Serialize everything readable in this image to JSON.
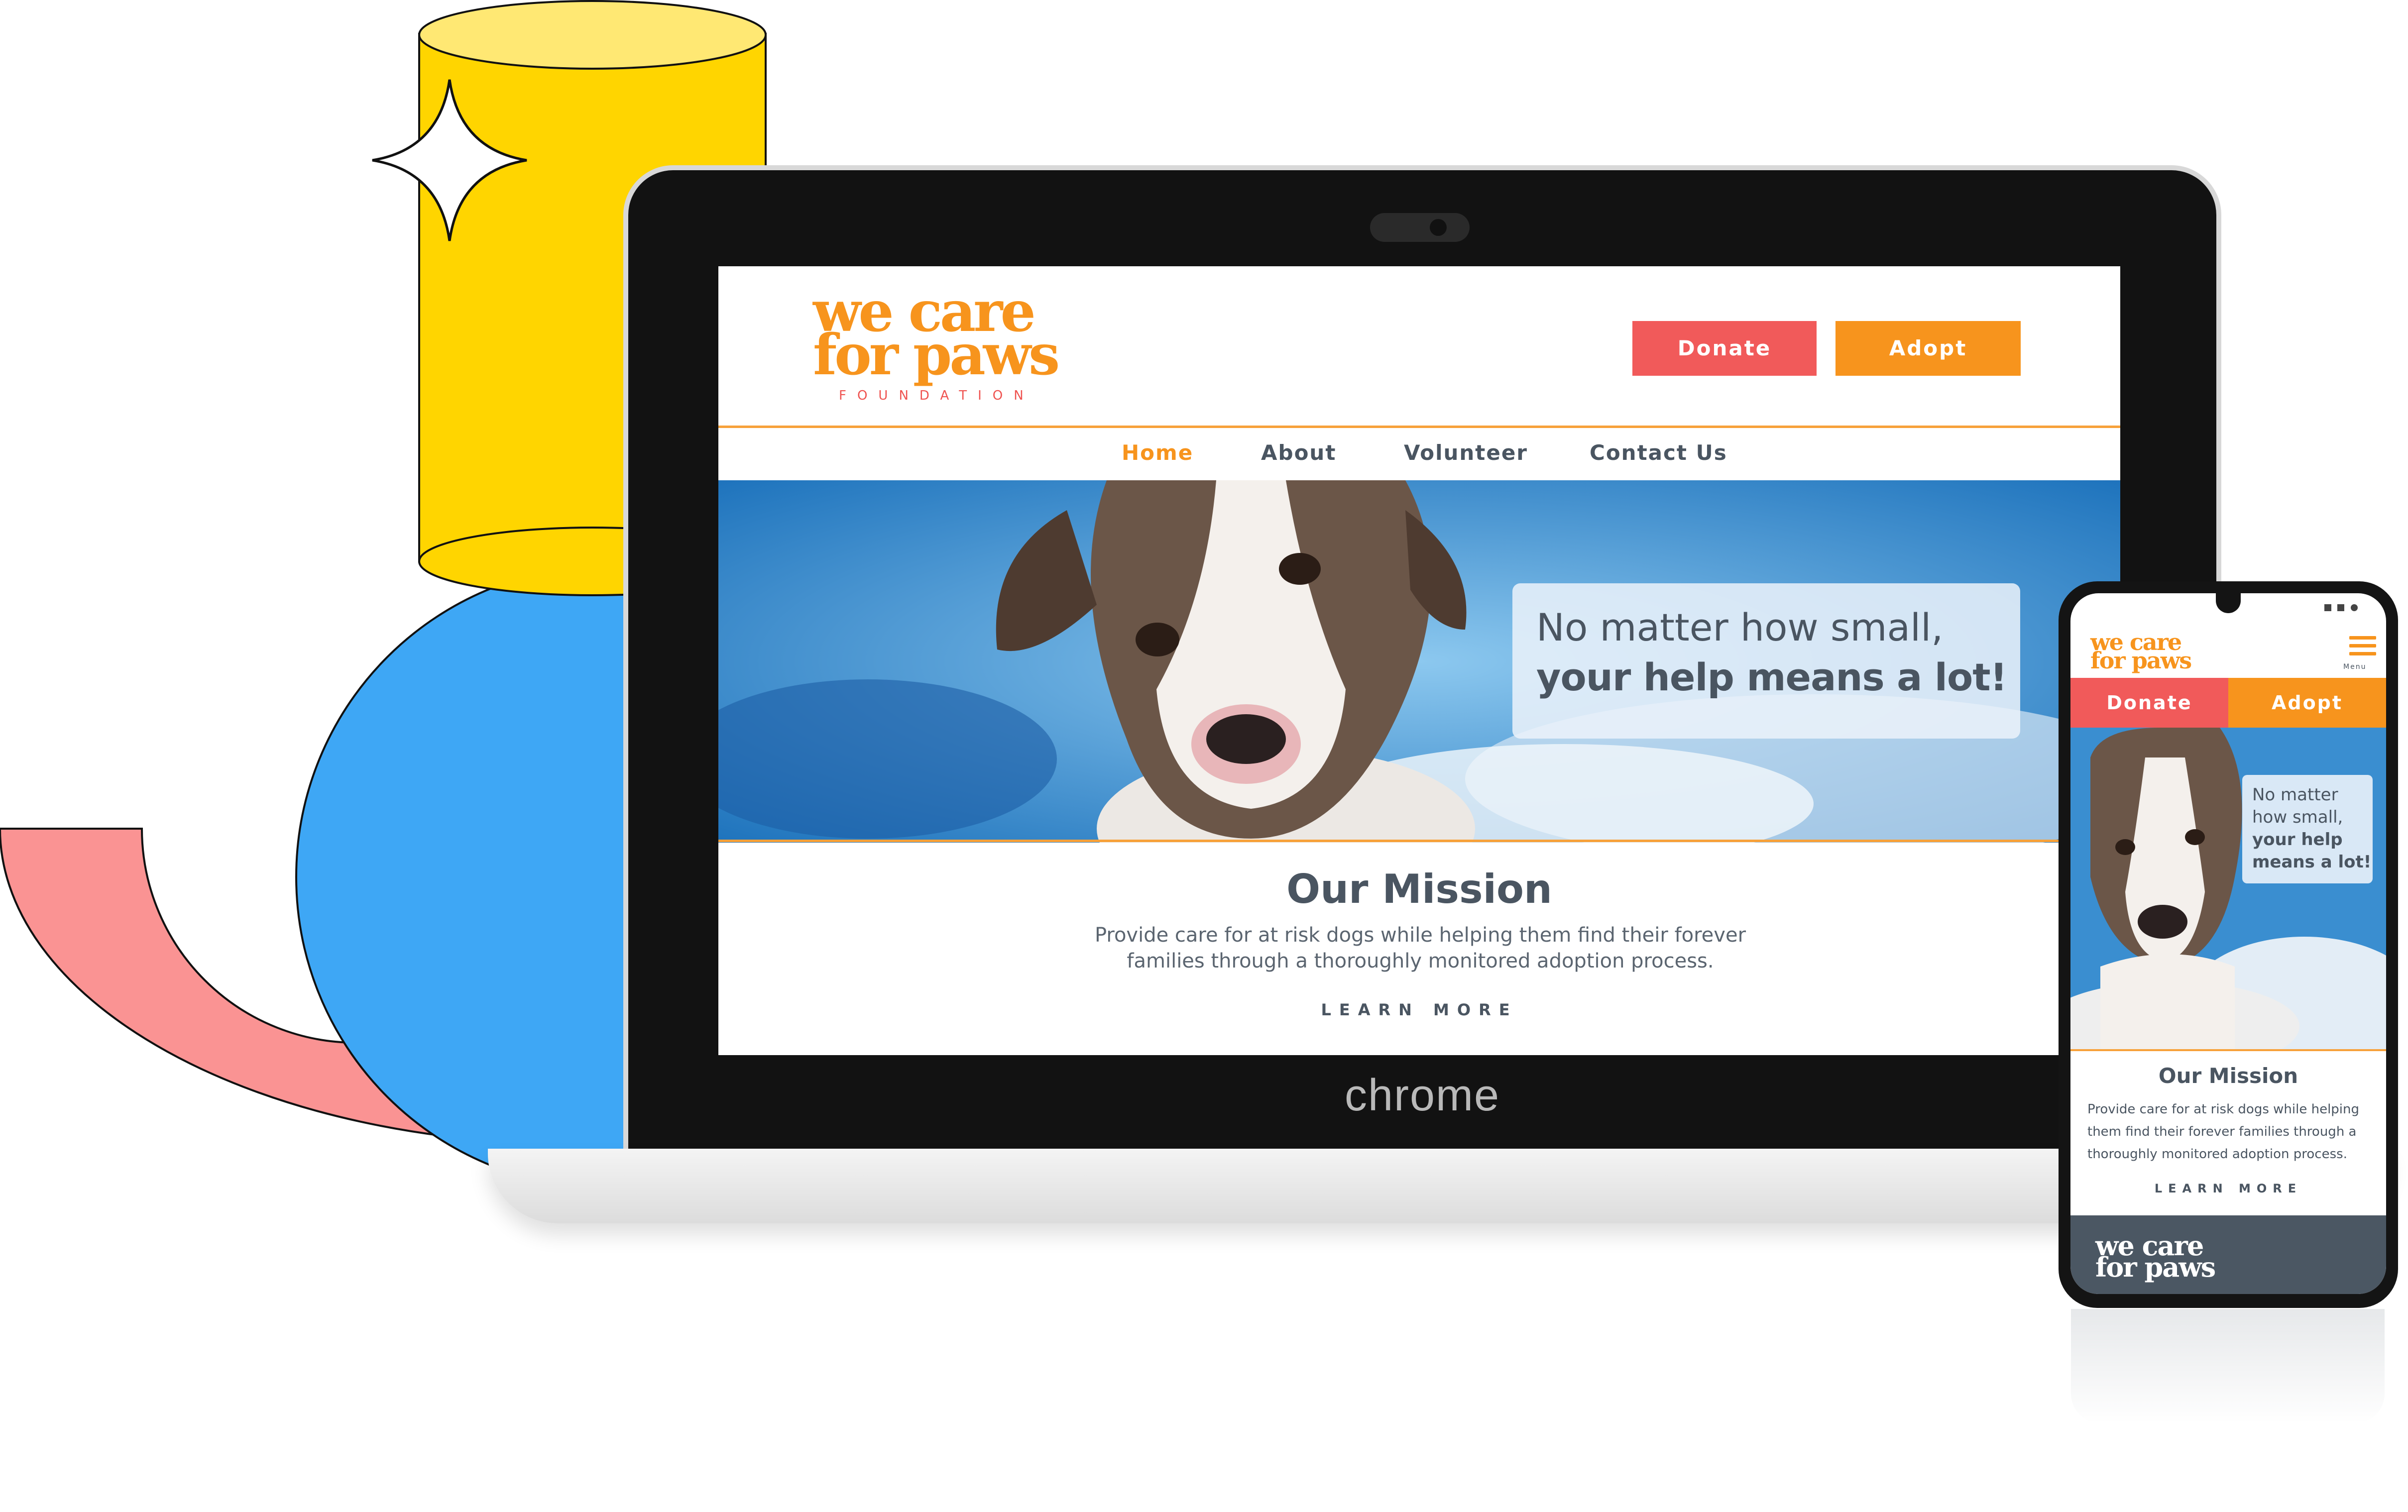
{
  "site": {
    "logo_line1": "we care",
    "logo_line2": "for paws",
    "logo_sub": "FOUNDATION",
    "donate_label": "Donate",
    "adopt_label": "Adopt",
    "nav": [
      {
        "label": "Home",
        "active": true
      },
      {
        "label": "About",
        "active": false
      },
      {
        "label": "Volunteer",
        "active": false
      },
      {
        "label": "Contact Us",
        "active": false
      }
    ],
    "hero_line1": "No matter how small,",
    "hero_line2": "your help means a lot!",
    "mission_title": "Our Mission",
    "mission_body_1": "Provide care for at risk dogs while helping them find their forever",
    "mission_body_2": "families through a thoroughly monitored adoption process.",
    "learn_more": "LEARN MORE"
  },
  "device": {
    "laptop_brand": "chrome"
  },
  "phone": {
    "logo_line1": "we care",
    "logo_line2": "for paws",
    "menu_label": "Menu",
    "donate_label": "Donate",
    "adopt_label": "Adopt",
    "hero_lines": [
      "No matter",
      "how small,",
      "your help",
      "means a lot!"
    ],
    "mission_title": "Our Mission",
    "mission_body": [
      "Provide care for at risk dogs while helping",
      "them find their forever families through a",
      "thoroughly monitored adoption process."
    ],
    "learn_more": "LEARN MORE",
    "footer_logo_line1": "we care",
    "footer_logo_line2": "for paws"
  },
  "colors": {
    "orange": "#f7941d",
    "coral": "#f15a5a",
    "slate": "#4a5561",
    "yellow": "#ffd500",
    "blue": "#3ea7f5",
    "pink": "#fa9393"
  }
}
